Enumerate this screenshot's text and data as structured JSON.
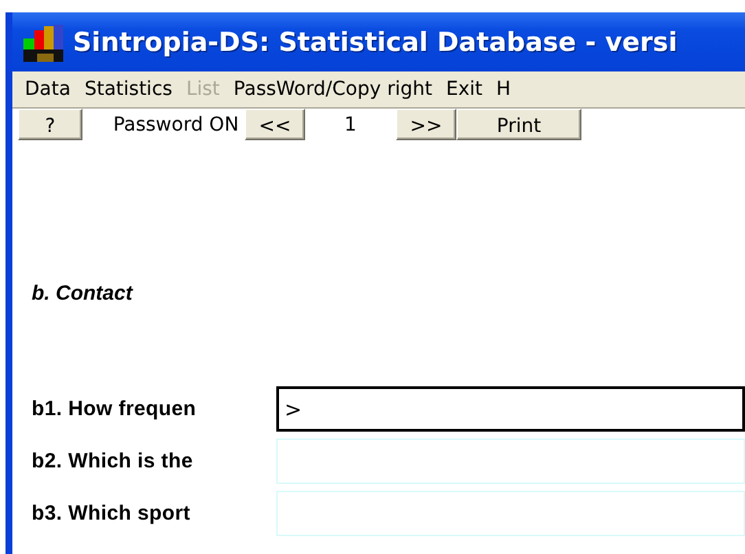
{
  "window": {
    "title": "Sintropia-DS: Statistical Database - versi"
  },
  "menu": [
    {
      "label": "Data",
      "disabled": false
    },
    {
      "label": "Statistics",
      "disabled": false
    },
    {
      "label": "List",
      "disabled": true
    },
    {
      "label": "PassWord/Copy right",
      "disabled": false
    },
    {
      "label": "Exit",
      "disabled": false
    },
    {
      "label": "H",
      "disabled": false
    }
  ],
  "toolbar": [
    {
      "kind": "button",
      "label": "?"
    },
    {
      "kind": "text",
      "label": "Password ON"
    },
    {
      "kind": "button",
      "label": "<<"
    },
    {
      "kind": "text",
      "label": "1"
    },
    {
      "kind": "button",
      "label": ">>"
    },
    {
      "kind": "button",
      "label": "Print"
    }
  ],
  "section": {
    "title": "b. Contact"
  },
  "questions": [
    {
      "label": "b1. How frequen",
      "value": ">",
      "focused": true
    },
    {
      "label": "b2. Which is the",
      "focused": false
    },
    {
      "label": "b3. Which sport",
      "focused": false
    }
  ]
}
